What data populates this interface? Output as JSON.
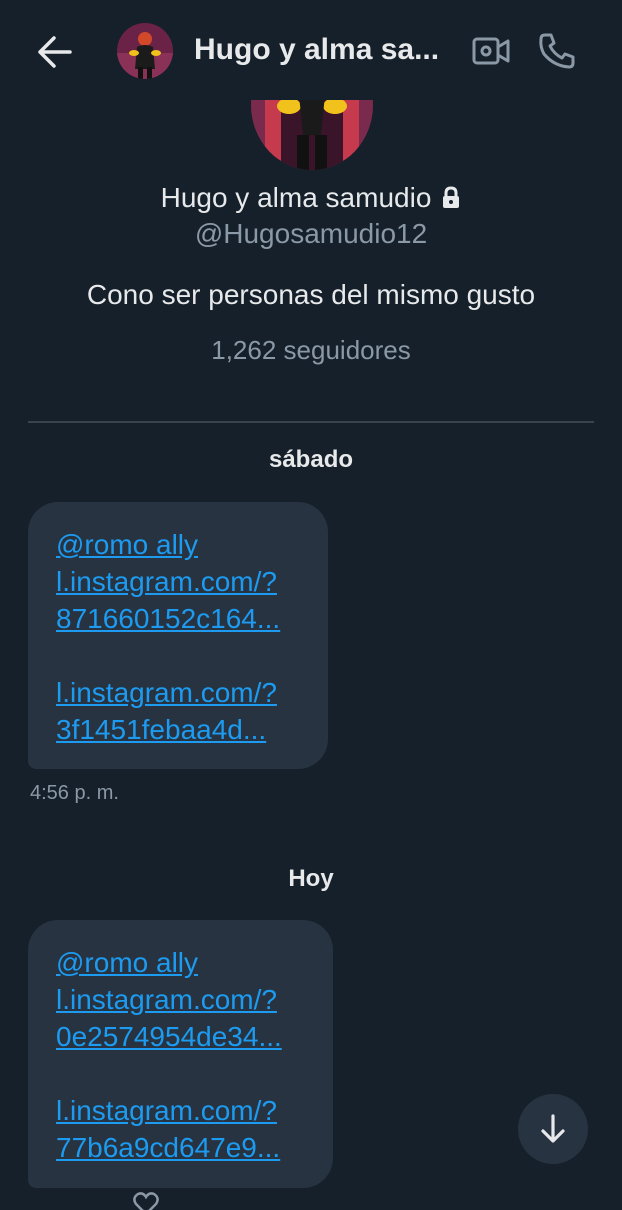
{
  "header": {
    "title": "Hugo y alma sa...",
    "back_icon": "arrow-left-icon",
    "video_icon": "video-call-icon",
    "call_icon": "phone-icon"
  },
  "profile": {
    "name": "Hugo y alma samudio",
    "handle": "@Hugosamudio12",
    "bio": "Cono ser personas del mismo gusto",
    "followers": "1,262 seguidores",
    "lock_icon": "lock-icon"
  },
  "conversation": {
    "groups": [
      {
        "date_label": "sábado",
        "message": {
          "mention": "@romo ally",
          "link1_line1": "l.instagram.com/?",
          "link1_line2": "871660152c164...",
          "link2_line1": "l.instagram.com/?",
          "link2_line2": "3f1451febaa4d...",
          "time": "4:56 p. m."
        }
      },
      {
        "date_label": "Hoy",
        "message": {
          "mention": "@romo ally",
          "link1_line1": "l.instagram.com/?",
          "link1_line2": "0e2574954de34...",
          "link2_line1": "l.instagram.com/?",
          "link2_line2": "77b6a9cd647e9..."
        }
      }
    ]
  },
  "scroll_button_icon": "arrow-down-icon",
  "colors": {
    "background": "#15202b",
    "bubble": "#273340",
    "link": "#1d9bf0",
    "text_primary": "#e7e9ea",
    "text_secondary": "#8b98a5",
    "divider": "#38444d"
  }
}
